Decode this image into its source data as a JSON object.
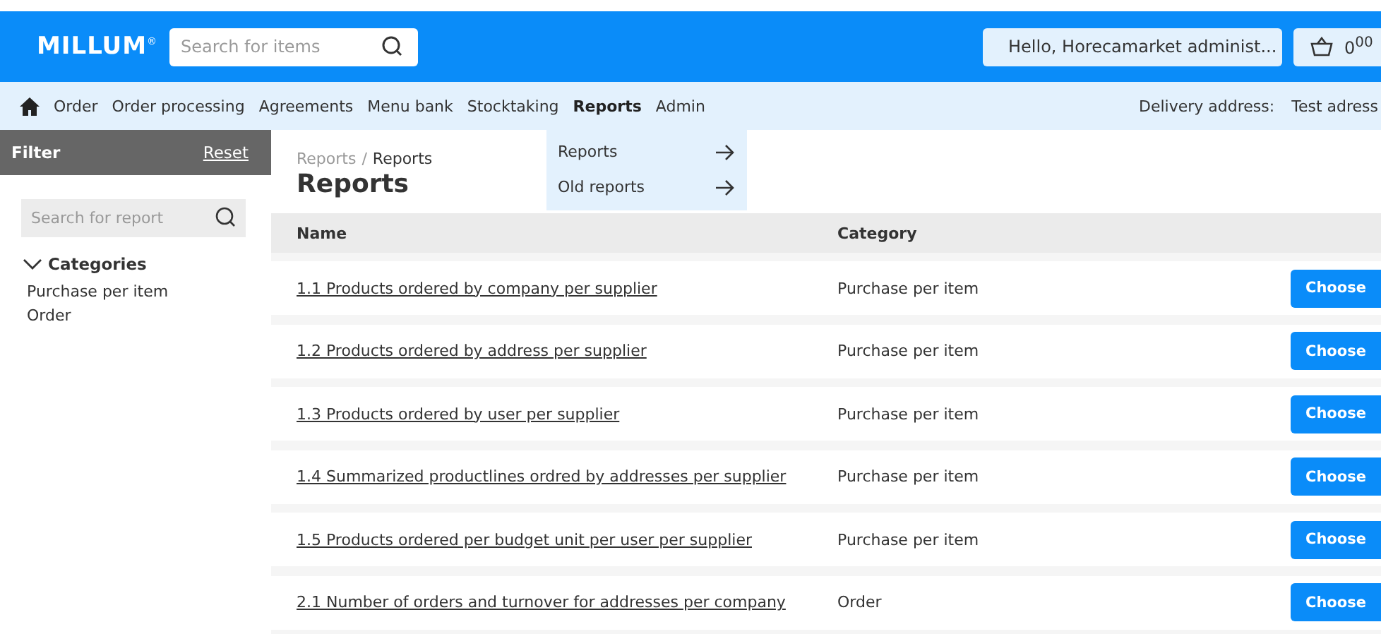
{
  "header": {
    "logo": "MILLUM",
    "logo_mark": "®",
    "search": {
      "placeholder": "Search for items"
    },
    "user_button": "Hello, Horecamarket administ...",
    "cart": "0$^{00}$"
  },
  "nav": {
    "items": [
      {
        "label": "Order",
        "selected": false
      },
      {
        "label": "Order processing",
        "selected": false
      },
      {
        "label": "Agreements",
        "selected": false
      },
      {
        "label": "Menu bank",
        "selected": false
      },
      {
        "label": "Stocktaking",
        "selected": false
      },
      {
        "label": "Reports",
        "selected": true
      },
      {
        "label": "Admin",
        "selected": false
      }
    ],
    "delivery_label": "Delivery address:",
    "delivery_value": "Test adress"
  },
  "dropdown": [
    "Reports",
    "Old reports"
  ],
  "sidebar": {
    "title": "Filter",
    "reset": "Reset",
    "search": {
      "placeholder": "Search for report"
    },
    "categories_title": "Categories",
    "expanded": true,
    "categories": [
      "Purchase per item",
      "Order"
    ]
  },
  "breadcrumb": [
    "Reports",
    "Reports"
  ],
  "breadcrumb_separator": "/",
  "title": "Reports",
  "table": {
    "columns": [
      "Name",
      "Category"
    ],
    "rows": [
      {
        "name": "1.1 Products ordered by company per supplier",
        "category": "Purchase per item",
        "action": "Choose"
      },
      {
        "name": "1.2 Products ordered by address per supplier",
        "category": "Purchase per item",
        "action": "Choose"
      },
      {
        "name": "1.3 Products ordered by user per supplier",
        "category": "Purchase per item",
        "action": "Choose"
      },
      {
        "name": "1.4 Summarized productlines ordred by addresses per supplier",
        "category": "Purchase per item",
        "action": "Choose"
      },
      {
        "name": "1.5 Products ordered per budget unit per user per supplier",
        "category": "Purchase per item",
        "action": "Choose"
      },
      {
        "name": "2.1 Number of orders and turnover for addresses per company",
        "category": "Order",
        "action": "Choose"
      }
    ]
  }
}
